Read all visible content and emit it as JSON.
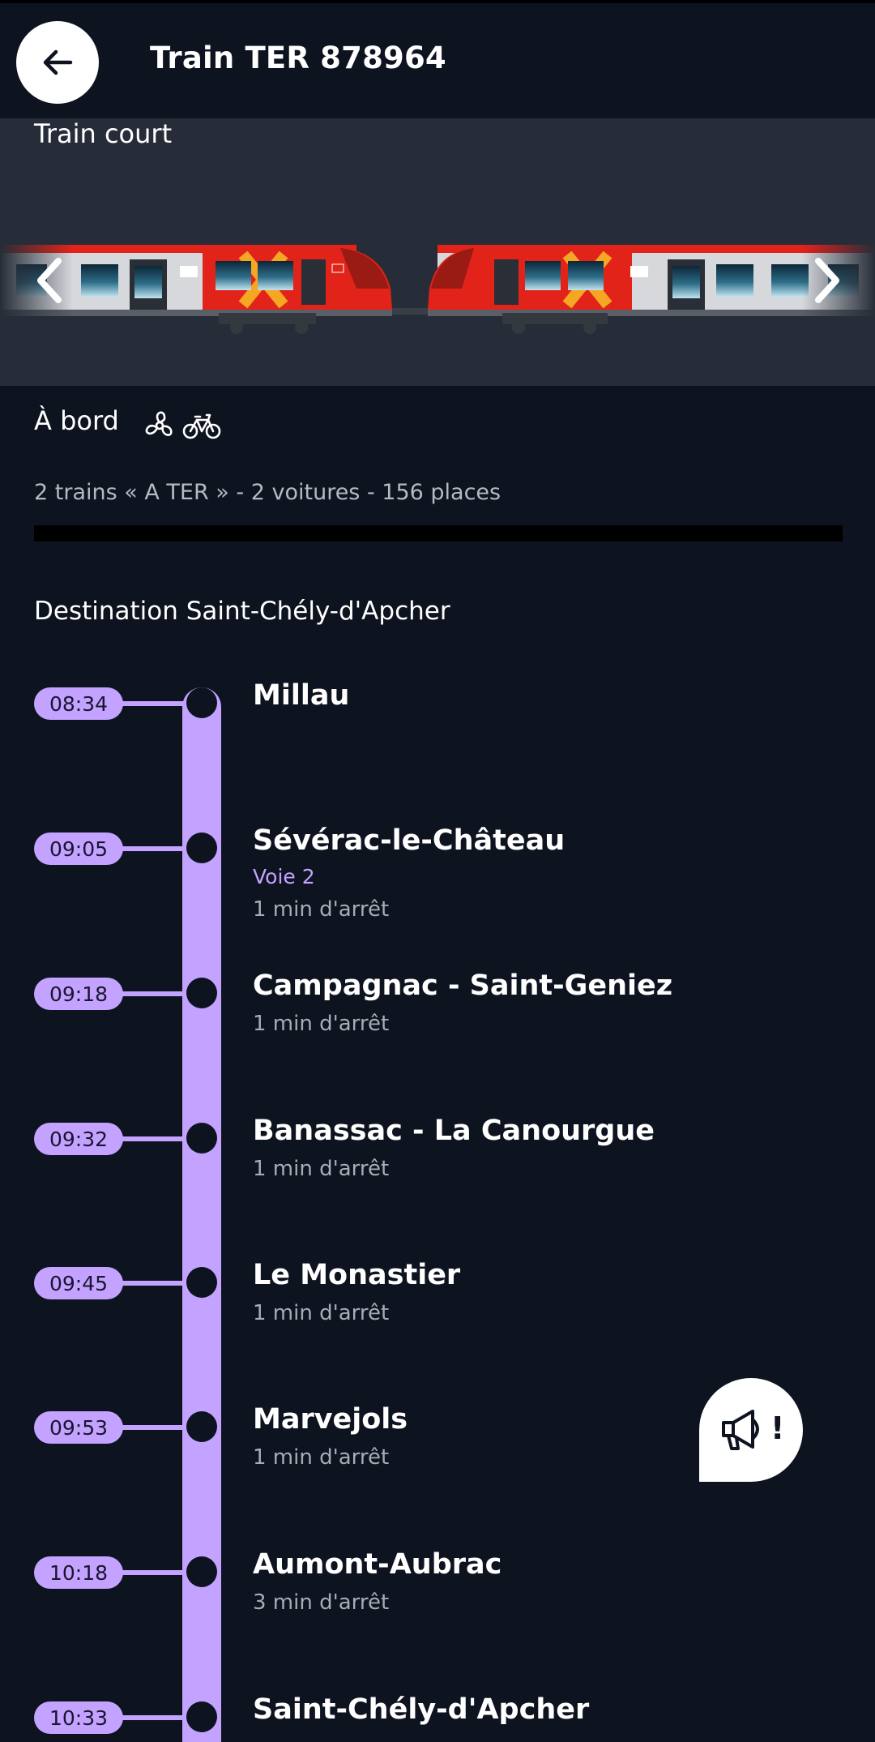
{
  "header": {
    "title": "Train TER 878964",
    "back_icon": "arrow-left-icon"
  },
  "composition": {
    "label": "Train court",
    "image": "twin-ter-railcars",
    "colors": {
      "body": "#d6d8dc",
      "livery_red": "#e2231a",
      "livery_orange": "#f5a623"
    }
  },
  "onboard": {
    "title": "À bord",
    "icons": [
      "fan-icon",
      "bicycle-icon"
    ],
    "details": "2 trains « A TER » - 2 voitures - 156 places"
  },
  "destination": "Destination Saint-Chély-d'Apcher",
  "stops": [
    {
      "time": "08:34",
      "name": "Millau"
    },
    {
      "time": "09:05",
      "name": "Sévérac-le-Château",
      "track": "Voie 2",
      "duration": "1 min d'arrêt"
    },
    {
      "time": "09:18",
      "name": "Campagnac - Saint-Geniez",
      "duration": "1 min d'arrêt"
    },
    {
      "time": "09:32",
      "name": "Banassac - La Canourgue",
      "duration": "1 min d'arrêt"
    },
    {
      "time": "09:45",
      "name": "Le Monastier",
      "duration": "1 min d'arrêt"
    },
    {
      "time": "09:53",
      "name": "Marvejols",
      "duration": "1 min d'arrêt"
    },
    {
      "time": "10:18",
      "name": "Aumont-Aubrac",
      "duration": "3 min d'arrêt"
    },
    {
      "time": "10:33",
      "name": "Saint-Chély-d'Apcher"
    }
  ],
  "feedback": {
    "icon": "megaphone-icon",
    "mark": "!"
  },
  "colors": {
    "background": "#0e1320",
    "panel": "#272d38",
    "accent": "#c3a3ff",
    "muted_text": "#a8acb6"
  }
}
